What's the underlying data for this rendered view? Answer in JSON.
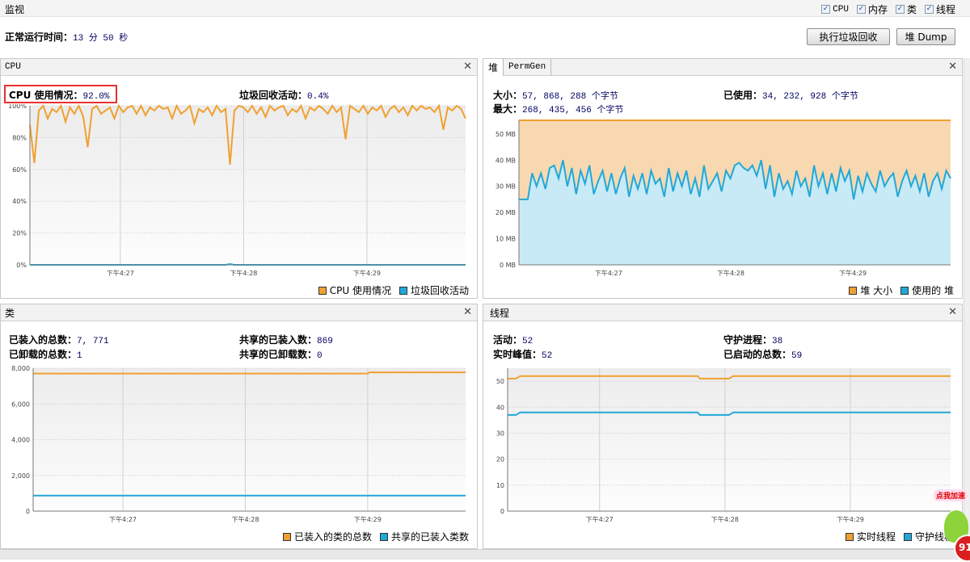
{
  "title": "监视",
  "checkboxes": [
    {
      "label": "CPU",
      "checked": true
    },
    {
      "label": "内存",
      "checked": true
    },
    {
      "label": "类",
      "checked": true
    },
    {
      "label": "线程",
      "checked": true
    }
  ],
  "uptime": {
    "label": "正常运行时间：",
    "value": "13 分 50 秒"
  },
  "buttons": {
    "gc": "执行垃圾回收",
    "heap_dump": "堆 Dump"
  },
  "colors": {
    "orange": "#f0a030",
    "blue": "#20a8d8",
    "highlight": "#e83030"
  },
  "cpu": {
    "title": "CPU",
    "usage_label": "CPU 使用情况：",
    "usage_value": "92.0%",
    "gc_label": "垃圾回收活动：",
    "gc_value": "0.4%",
    "legend": [
      "CPU 使用情况",
      "垃圾回收活动"
    ]
  },
  "heap": {
    "tabs": [
      "堆",
      "PermGen"
    ],
    "size_label": "大小：",
    "size_value": "57, 868, 288 个字节",
    "used_label": "已使用：",
    "used_value": "34, 232, 928 个字节",
    "max_label": "最大：",
    "max_value": "268, 435, 456 个字节",
    "legend": [
      "堆 大小",
      "使用的 堆"
    ]
  },
  "classes": {
    "title": "类",
    "loaded_label": "已装入的总数：",
    "loaded_value": "7, 771",
    "unloaded_label": "已卸载的总数：",
    "unloaded_value": "1",
    "shared_loaded_label": "共享的已装入数：",
    "shared_loaded_value": "869",
    "shared_unloaded_label": "共享的已卸载数：",
    "shared_unloaded_value": "0",
    "legend": [
      "已装入的类的总数",
      "共享的已装入类数"
    ]
  },
  "threads": {
    "title": "线程",
    "live_label": "活动：",
    "live_value": "52",
    "peak_label": "实时峰值：",
    "peak_value": "52",
    "daemon_label": "守护进程：",
    "daemon_value": "38",
    "started_label": "已启动的总数：",
    "started_value": "59",
    "legend": [
      "实时线程",
      "守护线程"
    ]
  },
  "badge": {
    "text": "点我加速",
    "count": "91"
  },
  "chart_data": [
    {
      "id": "cpu",
      "type": "line",
      "x_range": [
        "16:26:16",
        "16:29:48"
      ],
      "xticks": [
        "下午4:27",
        "下午4:28",
        "下午4:29"
      ],
      "xtick_times": [
        "16:27:00",
        "16:28:00",
        "16:29:00"
      ],
      "ylim": [
        0,
        100
      ],
      "yticks": [
        "0%",
        "20%",
        "40%",
        "60%",
        "80%",
        "100%"
      ],
      "ytick_values": [
        0,
        20,
        40,
        60,
        80,
        100
      ],
      "grid": true,
      "series": [
        {
          "name": "CPU 使用情况",
          "color": "#f0a030",
          "fill": false,
          "values": [
            88,
            64,
            97,
            100,
            92,
            98,
            96,
            100,
            90,
            99,
            95,
            100,
            93,
            74,
            98,
            100,
            95,
            97,
            99,
            92,
            100,
            96,
            99,
            100,
            95,
            100,
            94,
            99,
            97,
            100,
            98,
            99,
            92,
            100,
            95,
            97,
            100,
            89,
            98,
            96,
            99,
            94,
            100,
            96,
            98,
            63,
            97,
            100,
            99,
            96,
            100,
            95,
            99,
            93,
            100,
            97,
            99,
            100,
            94,
            98,
            96,
            100,
            92,
            99,
            97,
            100,
            98,
            95,
            100,
            96,
            99,
            79,
            100,
            98,
            96,
            100,
            95,
            99,
            97,
            100,
            93,
            98,
            100,
            96,
            99,
            94,
            100,
            97,
            100,
            98,
            99,
            96,
            100,
            85,
            99,
            97,
            100,
            98,
            92
          ]
        },
        {
          "name": "垃圾回收活动",
          "color": "#20a8d8",
          "fill": false,
          "values": [
            0,
            0,
            0,
            0,
            0,
            0,
            0,
            0,
            0,
            0,
            0,
            0,
            0,
            0,
            0,
            0,
            0,
            0,
            0,
            0,
            0,
            0,
            0,
            0,
            0,
            0,
            0,
            0,
            0,
            0,
            0,
            0,
            0,
            0,
            0,
            0,
            0,
            0,
            0,
            0,
            0,
            0,
            0,
            0,
            0,
            0.5,
            0,
            0,
            0,
            0,
            0,
            0,
            0,
            0,
            0,
            0,
            0,
            0,
            0,
            0,
            0,
            0,
            0,
            0,
            0,
            0,
            0,
            0,
            0,
            0,
            0,
            0,
            0,
            0,
            0,
            0,
            0,
            0,
            0,
            0,
            0,
            0,
            0,
            0,
            0,
            0,
            0,
            0,
            0,
            0,
            0,
            0,
            0,
            0,
            0,
            0,
            0,
            0,
            0
          ]
        }
      ]
    },
    {
      "id": "heap",
      "type": "area",
      "x_range": [
        "16:26:16",
        "16:29:48"
      ],
      "xticks": [
        "下午4:27",
        "下午4:28",
        "下午4:29"
      ],
      "xtick_times": [
        "16:27:00",
        "16:28:00",
        "16:29:00"
      ],
      "ylim": [
        0,
        55.2
      ],
      "yticks": [
        "0 MB",
        "10 MB",
        "20 MB",
        "30 MB",
        "40 MB",
        "50 MB"
      ],
      "ytick_values": [
        0,
        10,
        20,
        30,
        40,
        50
      ],
      "grid": true,
      "series": [
        {
          "name": "堆 大小",
          "color": "#f0a030",
          "fill": "#f8d8b0",
          "values": [
            55.2,
            55.2
          ]
        },
        {
          "name": "使用的 堆",
          "color": "#20a8d8",
          "fill": "#c8eaf6",
          "values": [
            25,
            25,
            25,
            35,
            30,
            35,
            29,
            37,
            38,
            33,
            40,
            30,
            37,
            27,
            36,
            31,
            38,
            27,
            32,
            36,
            28,
            35,
            27,
            33,
            37,
            26,
            34,
            29,
            35,
            27,
            36,
            31,
            33,
            26,
            37,
            28,
            35,
            30,
            36,
            27,
            33,
            26,
            38,
            29,
            32,
            35,
            28,
            36,
            33,
            38,
            39,
            37,
            36,
            38,
            34,
            40,
            29,
            38,
            26,
            35,
            29,
            32,
            27,
            36,
            30,
            33,
            26,
            38,
            30,
            35,
            27,
            35,
            28,
            37,
            32,
            36,
            25,
            34,
            28,
            35,
            31,
            28,
            36,
            30,
            33,
            35,
            26,
            32,
            36,
            30,
            34,
            28,
            35,
            26,
            32,
            35,
            29,
            36,
            33
          ]
        }
      ]
    },
    {
      "id": "classes",
      "type": "line",
      "x_range": [
        "16:26:16",
        "16:29:48"
      ],
      "xticks": [
        "下午4:27",
        "下午4:28",
        "下午4:29"
      ],
      "xtick_times": [
        "16:27:00",
        "16:28:00",
        "16:29:00"
      ],
      "ylim": [
        0,
        8000
      ],
      "yticks": [
        "0",
        "2,000",
        "4,000",
        "6,000",
        "8,000"
      ],
      "ytick_values": [
        0,
        2000,
        4000,
        6000,
        8000
      ],
      "grid": true,
      "series": [
        {
          "name": "已装入的类的总数",
          "color": "#f0a030",
          "fill": false,
          "points": [
            [
              "16:26:16",
              7700
            ],
            [
              "16:29:00",
              7700
            ],
            [
              "16:29:01",
              7771
            ],
            [
              "16:29:48",
              7771
            ]
          ]
        },
        {
          "name": "共享的已装入类数",
          "color": "#20a8d8",
          "fill": false,
          "points": [
            [
              "16:26:16",
              869
            ],
            [
              "16:29:48",
              869
            ]
          ]
        }
      ]
    },
    {
      "id": "threads",
      "type": "line",
      "x_range": [
        "16:26:16",
        "16:29:48"
      ],
      "xticks": [
        "下午4:27",
        "下午4:28",
        "下午4:29"
      ],
      "xtick_times": [
        "16:27:00",
        "16:28:00",
        "16:29:00"
      ],
      "ylim": [
        0,
        55
      ],
      "yticks": [
        "0",
        "10",
        "20",
        "30",
        "40",
        "50"
      ],
      "ytick_values": [
        0,
        10,
        20,
        30,
        40,
        50
      ],
      "grid": true,
      "series": [
        {
          "name": "实时线程",
          "color": "#f0a030",
          "fill": false,
          "points": [
            [
              "16:26:16",
              51
            ],
            [
              "16:26:20",
              51
            ],
            [
              "16:26:22",
              52
            ],
            [
              "16:27:47",
              52
            ],
            [
              "16:27:48",
              51
            ],
            [
              "16:28:02",
              51
            ],
            [
              "16:28:04",
              52
            ],
            [
              "16:29:48",
              52
            ]
          ]
        },
        {
          "name": "守护线程",
          "color": "#20a8d8",
          "fill": false,
          "points": [
            [
              "16:26:16",
              37
            ],
            [
              "16:26:20",
              37
            ],
            [
              "16:26:22",
              38
            ],
            [
              "16:27:47",
              38
            ],
            [
              "16:27:48",
              37
            ],
            [
              "16:28:02",
              37
            ],
            [
              "16:28:04",
              38
            ],
            [
              "16:29:48",
              38
            ]
          ]
        }
      ]
    }
  ]
}
